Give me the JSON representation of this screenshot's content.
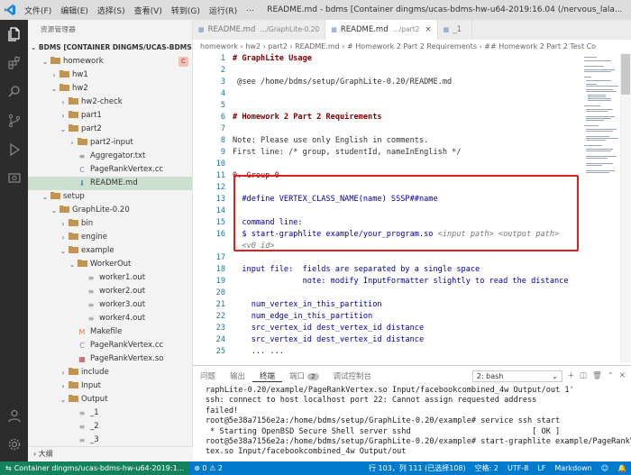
{
  "titlebar": {
    "menus": [
      "文件(F)",
      "编辑(E)",
      "选择(S)",
      "查看(V)",
      "转到(G)",
      "运行(R)",
      "..."
    ],
    "title": "README.md - bdms [Container dingms/ucas-bdms-hw-u64-2019:16.04 (/nervous_lala..."
  },
  "activity": [
    "explorer-icon",
    "extensions-icon",
    "search-icon",
    "source-control-icon",
    "run-debug-icon",
    "remote-explorer-icon"
  ],
  "sidebar": {
    "title": "资源管理器",
    "workspace": "BDMS [CONTAINER DINGMS/UCAS-BDMS-H...",
    "tree": [
      {
        "label": "homework",
        "depth": 1,
        "kind": "folder",
        "open": true,
        "badge": "C"
      },
      {
        "label": "hw1",
        "depth": 2,
        "kind": "folder",
        "open": false
      },
      {
        "label": "hw2",
        "depth": 2,
        "kind": "folder",
        "open": true
      },
      {
        "label": "hw2-check",
        "depth": 3,
        "kind": "folder",
        "open": false
      },
      {
        "label": "part1",
        "depth": 3,
        "kind": "folder",
        "open": false
      },
      {
        "label": "part2",
        "depth": 3,
        "kind": "folder",
        "open": true
      },
      {
        "label": "part2-input",
        "depth": 4,
        "kind": "folder",
        "open": false
      },
      {
        "label": "Aggregator.txt",
        "depth": 4,
        "kind": "txt"
      },
      {
        "label": "PageRankVertex.cc",
        "depth": 4,
        "kind": "cc"
      },
      {
        "label": "README.md",
        "depth": 4,
        "kind": "md",
        "selected": true
      },
      {
        "label": "setup",
        "depth": 1,
        "kind": "folder",
        "open": true
      },
      {
        "label": "GraphLite-0.20",
        "depth": 2,
        "kind": "folder",
        "open": true
      },
      {
        "label": "bin",
        "depth": 3,
        "kind": "folder",
        "open": false
      },
      {
        "label": "engine",
        "depth": 3,
        "kind": "folder",
        "open": false
      },
      {
        "label": "example",
        "depth": 3,
        "kind": "folder",
        "open": true
      },
      {
        "label": "WorkerOut",
        "depth": 4,
        "kind": "folder",
        "open": true
      },
      {
        "label": "worker1.out",
        "depth": 5,
        "kind": "out"
      },
      {
        "label": "worker2.out",
        "depth": 5,
        "kind": "out"
      },
      {
        "label": "worker3.out",
        "depth": 5,
        "kind": "out"
      },
      {
        "label": "worker4.out",
        "depth": 5,
        "kind": "out"
      },
      {
        "label": "Makefile",
        "depth": 4,
        "kind": "make"
      },
      {
        "label": "PageRankVertex.cc",
        "depth": 4,
        "kind": "cc"
      },
      {
        "label": "PageRankVertex.so",
        "depth": 4,
        "kind": "so"
      },
      {
        "label": "include",
        "depth": 3,
        "kind": "folder",
        "open": false
      },
      {
        "label": "Input",
        "depth": 3,
        "kind": "folder",
        "open": false
      },
      {
        "label": "Output",
        "depth": 3,
        "kind": "folder",
        "open": true
      },
      {
        "label": "_1",
        "depth": 4,
        "kind": "out"
      },
      {
        "label": "_2",
        "depth": 4,
        "kind": "out"
      },
      {
        "label": "_3",
        "depth": 4,
        "kind": "out"
      }
    ],
    "outline": "大纲"
  },
  "tabs": [
    {
      "label": "README.md",
      "desc": ".../GraphLite-0.20",
      "active": false
    },
    {
      "label": "README.md",
      "desc": ".../part2",
      "active": true
    },
    {
      "label": "_1",
      "desc": "",
      "active": false
    }
  ],
  "breadcrumb": "homework › hw2 › part2 › README.md › # Homework 2 Part 2 Requirements › ## Homework 2 Part 2 Test Co",
  "editor": {
    "lines": [
      {
        "n": "1",
        "parts": [
          {
            "t": "# GraphLite Usage",
            "c": "hb"
          }
        ]
      },
      {
        "n": "2",
        "parts": []
      },
      {
        "n": "3",
        "parts": [
          {
            "t": " @see /home/bdms/setup/GraphLite-0.20/README.md",
            "c": "pl"
          }
        ]
      },
      {
        "n": "4",
        "parts": []
      },
      {
        "n": "5",
        "parts": []
      },
      {
        "n": "6",
        "parts": [
          {
            "t": "# Homework 2 Part 2 Requirements",
            "c": "hb"
          }
        ]
      },
      {
        "n": "7",
        "parts": []
      },
      {
        "n": "8",
        "parts": [
          {
            "t": "Note: Please use only English in comments.",
            "c": "pl"
          }
        ]
      },
      {
        "n": "9",
        "parts": [
          {
            "t": "First line: /* group, studentId, nameInEnglish */",
            "c": "pl"
          }
        ]
      },
      {
        "n": "10",
        "parts": []
      },
      {
        "n": "11",
        "parts": [
          {
            "t": "0. Group 0",
            "c": "h"
          }
        ]
      },
      {
        "n": "12",
        "parts": []
      },
      {
        "n": "13",
        "parts": [
          {
            "t": "  #define VERTEX_CLASS_NAME(name) SSSP##name",
            "c": "bl"
          }
        ]
      },
      {
        "n": "14",
        "parts": []
      },
      {
        "n": "15",
        "parts": [
          {
            "t": "  command line:",
            "c": "bl"
          }
        ]
      },
      {
        "n": "16",
        "parts": [
          {
            "t": "  $ start-graphlite example/your_program.so ",
            "c": "bl"
          },
          {
            "t": "<input path>",
            "c": "it"
          },
          {
            "t": " ",
            "c": "bl"
          },
          {
            "t": "<output path>",
            "c": "it"
          }
        ]
      },
      {
        "n": "",
        "parts": [
          {
            "t": "  ",
            "c": "bl"
          },
          {
            "t": "<v0 id>",
            "c": "it"
          }
        ]
      },
      {
        "n": "17",
        "parts": []
      },
      {
        "n": "18",
        "parts": [
          {
            "t": "  input file:  fields are separated by a single space",
            "c": "bl"
          }
        ]
      },
      {
        "n": "19",
        "parts": [
          {
            "t": "               note: modify InputFormatter slightly to read the distance",
            "c": "bl"
          }
        ]
      },
      {
        "n": "20",
        "parts": []
      },
      {
        "n": "21",
        "parts": [
          {
            "t": "    num_vertex_in_this_partition",
            "c": "bl"
          }
        ]
      },
      {
        "n": "22",
        "parts": [
          {
            "t": "    num_edge_in_this_partition",
            "c": "bl"
          }
        ]
      },
      {
        "n": "23",
        "parts": [
          {
            "t": "    src_vertex_id dest_vertex_id distance",
            "c": "bl"
          }
        ]
      },
      {
        "n": "24",
        "parts": [
          {
            "t": "    src_vertex_id dest_vertex_id distance",
            "c": "bl"
          }
        ]
      },
      {
        "n": "25",
        "parts": [
          {
            "t": "    ... ...",
            "c": "bl"
          }
        ]
      }
    ]
  },
  "panel": {
    "tabs": [
      "问题",
      "输出",
      "终端",
      "端口",
      "调试控制台"
    ],
    "active_tab": "终端",
    "ports_count": "2",
    "terminal_select": "2: bash",
    "terminal_lines": [
      "raphLite-0.20/example/PageRankVertex.so Input/facebookcombined_4w Output/out 1'",
      "ssh: connect to host localhost port 22: Cannot assign requested address",
      "failed!",
      "root@5e38a7156e2a:/home/bdms/setup/GraphLite-0.20/example# service ssh start",
      " * Starting OpenBSD Secure Shell server sshd                          [ OK ]",
      "root@5e38a7156e2a:/home/bdms/setup/GraphLite-0.20/example# start-graphlite example/PageRankVer",
      "tex.so Input/facebookcombined_4w Output/out"
    ]
  },
  "status": {
    "remote": "Container dingms/ucas-bdms-hw-u64-2019:1...",
    "errors": "0",
    "warnings": "2",
    "position": "行 103，列 111 (已选择108)",
    "spaces": "空格: 2",
    "encoding": "UTF-8",
    "eol": "LF",
    "language": "Markdown"
  },
  "colors": {
    "accent": "#007acc",
    "highlight_box": "#e02020",
    "remote": "#16825d"
  }
}
